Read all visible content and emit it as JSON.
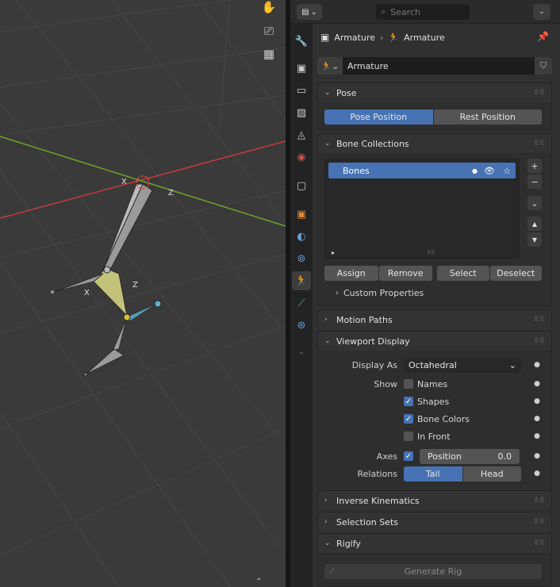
{
  "header": {
    "search_placeholder": "Search"
  },
  "viewport": {
    "tools": [
      "hand-icon",
      "camera-icon",
      "grid-icon"
    ],
    "bone_axes": [
      "X",
      "Z",
      "X",
      "Z"
    ]
  },
  "breadcrumb": {
    "object": "Armature",
    "data": "Armature"
  },
  "datablock": {
    "name": "Armature"
  },
  "pose": {
    "title": "Pose",
    "pose_position": "Pose Position",
    "rest_position": "Rest Position"
  },
  "bone_collections": {
    "title": "Bone Collections",
    "items": [
      {
        "label": "Bones"
      }
    ],
    "assign": "Assign",
    "remove": "Remove",
    "select": "Select",
    "deselect": "Deselect",
    "custom_properties": "Custom Properties"
  },
  "motion_paths": {
    "title": "Motion Paths"
  },
  "viewport_display": {
    "title": "Viewport Display",
    "display_as_label": "Display As",
    "display_as_value": "Octahedral",
    "show_label": "Show",
    "names": "Names",
    "shapes": "Shapes",
    "bone_colors": "Bone Colors",
    "in_front": "In Front",
    "axes_label": "Axes",
    "axes_position_label": "Position",
    "axes_position_value": "0.0",
    "relations_label": "Relations",
    "tail": "Tail",
    "head": "Head",
    "checks": {
      "names": false,
      "shapes": true,
      "bone_colors": true,
      "in_front": false,
      "axes": true
    }
  },
  "inverse_kinematics": {
    "title": "Inverse Kinematics"
  },
  "selection_sets": {
    "title": "Selection Sets"
  },
  "rigify": {
    "title": "Rigify",
    "generate_rig": "Generate Rig"
  },
  "colors": {
    "accent": "#4772b3",
    "bone_fill": "#a9a9a9",
    "bone_selected": "#c2c27a",
    "bone_active": "#5fb4d6",
    "x_axis": "#c8393e",
    "y_axis": "#6fa22a"
  }
}
